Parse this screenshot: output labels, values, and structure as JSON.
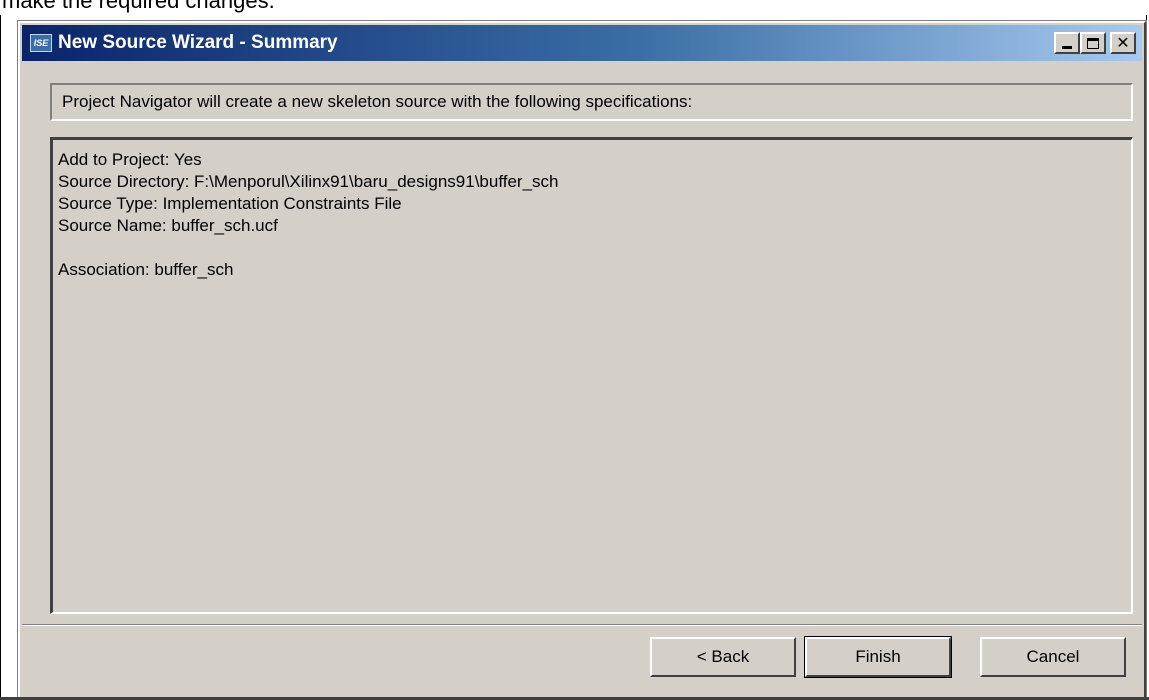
{
  "caption": {
    "text": "make the required changes."
  },
  "window": {
    "icon_label": "ISE",
    "title": "New Source Wizard - Summary",
    "controls": {
      "minimize_icon": "minimize-icon",
      "maximize_icon": "maximize-icon",
      "close_glyph": "✕"
    }
  },
  "info": {
    "text": "Project Navigator will create a new skeleton source with the following specifications:"
  },
  "specs": {
    "lines": [
      "Add to Project: Yes",
      "Source Directory: F:\\Menporul\\Xilinx91\\baru_designs91\\buffer_sch",
      "Source Type: Implementation Constraints File",
      "Source Name: buffer_sch.ucf",
      "",
      "Association: buffer_sch"
    ]
  },
  "buttons": {
    "back": "< Back",
    "finish": "Finish",
    "cancel": "Cancel"
  },
  "colors": {
    "titlebar_start": "#0a246a",
    "titlebar_end": "#a6caf0",
    "face": "#d4d0c8"
  }
}
